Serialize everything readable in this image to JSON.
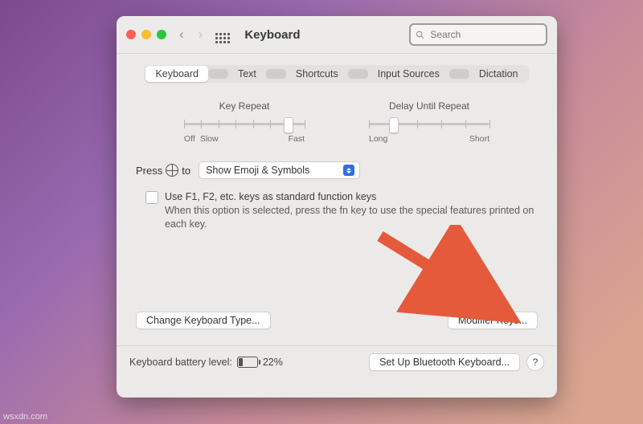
{
  "toolbar": {
    "title": "Keyboard",
    "search_placeholder": "Search"
  },
  "tabs": [
    "Keyboard",
    "Text",
    "Shortcuts",
    "Input Sources",
    "Dictation"
  ],
  "tabs_selected_index": 0,
  "sliders": {
    "key_repeat": {
      "label": "Key Repeat",
      "left1": "Off",
      "left2": "Slow",
      "right": "Fast",
      "ticks": 8,
      "knob_pct": 86
    },
    "delay_repeat": {
      "label": "Delay Until Repeat",
      "left": "Long",
      "right": "Short",
      "ticks": 6,
      "knob_pct": 20
    }
  },
  "globe_row": {
    "press": "Press",
    "to": "to",
    "value": "Show Emoji & Symbols"
  },
  "fn_option": {
    "checked": false,
    "title": "Use F1, F2, etc. keys as standard function keys",
    "desc": "When this option is selected, press the fn key to use the special features printed on each key."
  },
  "buttons": {
    "change_type": "Change Keyboard Type...",
    "modifier": "Modifier Keys...",
    "setup_bt": "Set Up Bluetooth Keyboard...",
    "help": "?"
  },
  "footer": {
    "battery_label": "Keyboard battery level:",
    "battery_pct": "22%"
  },
  "watermark": "wsxdn.com"
}
